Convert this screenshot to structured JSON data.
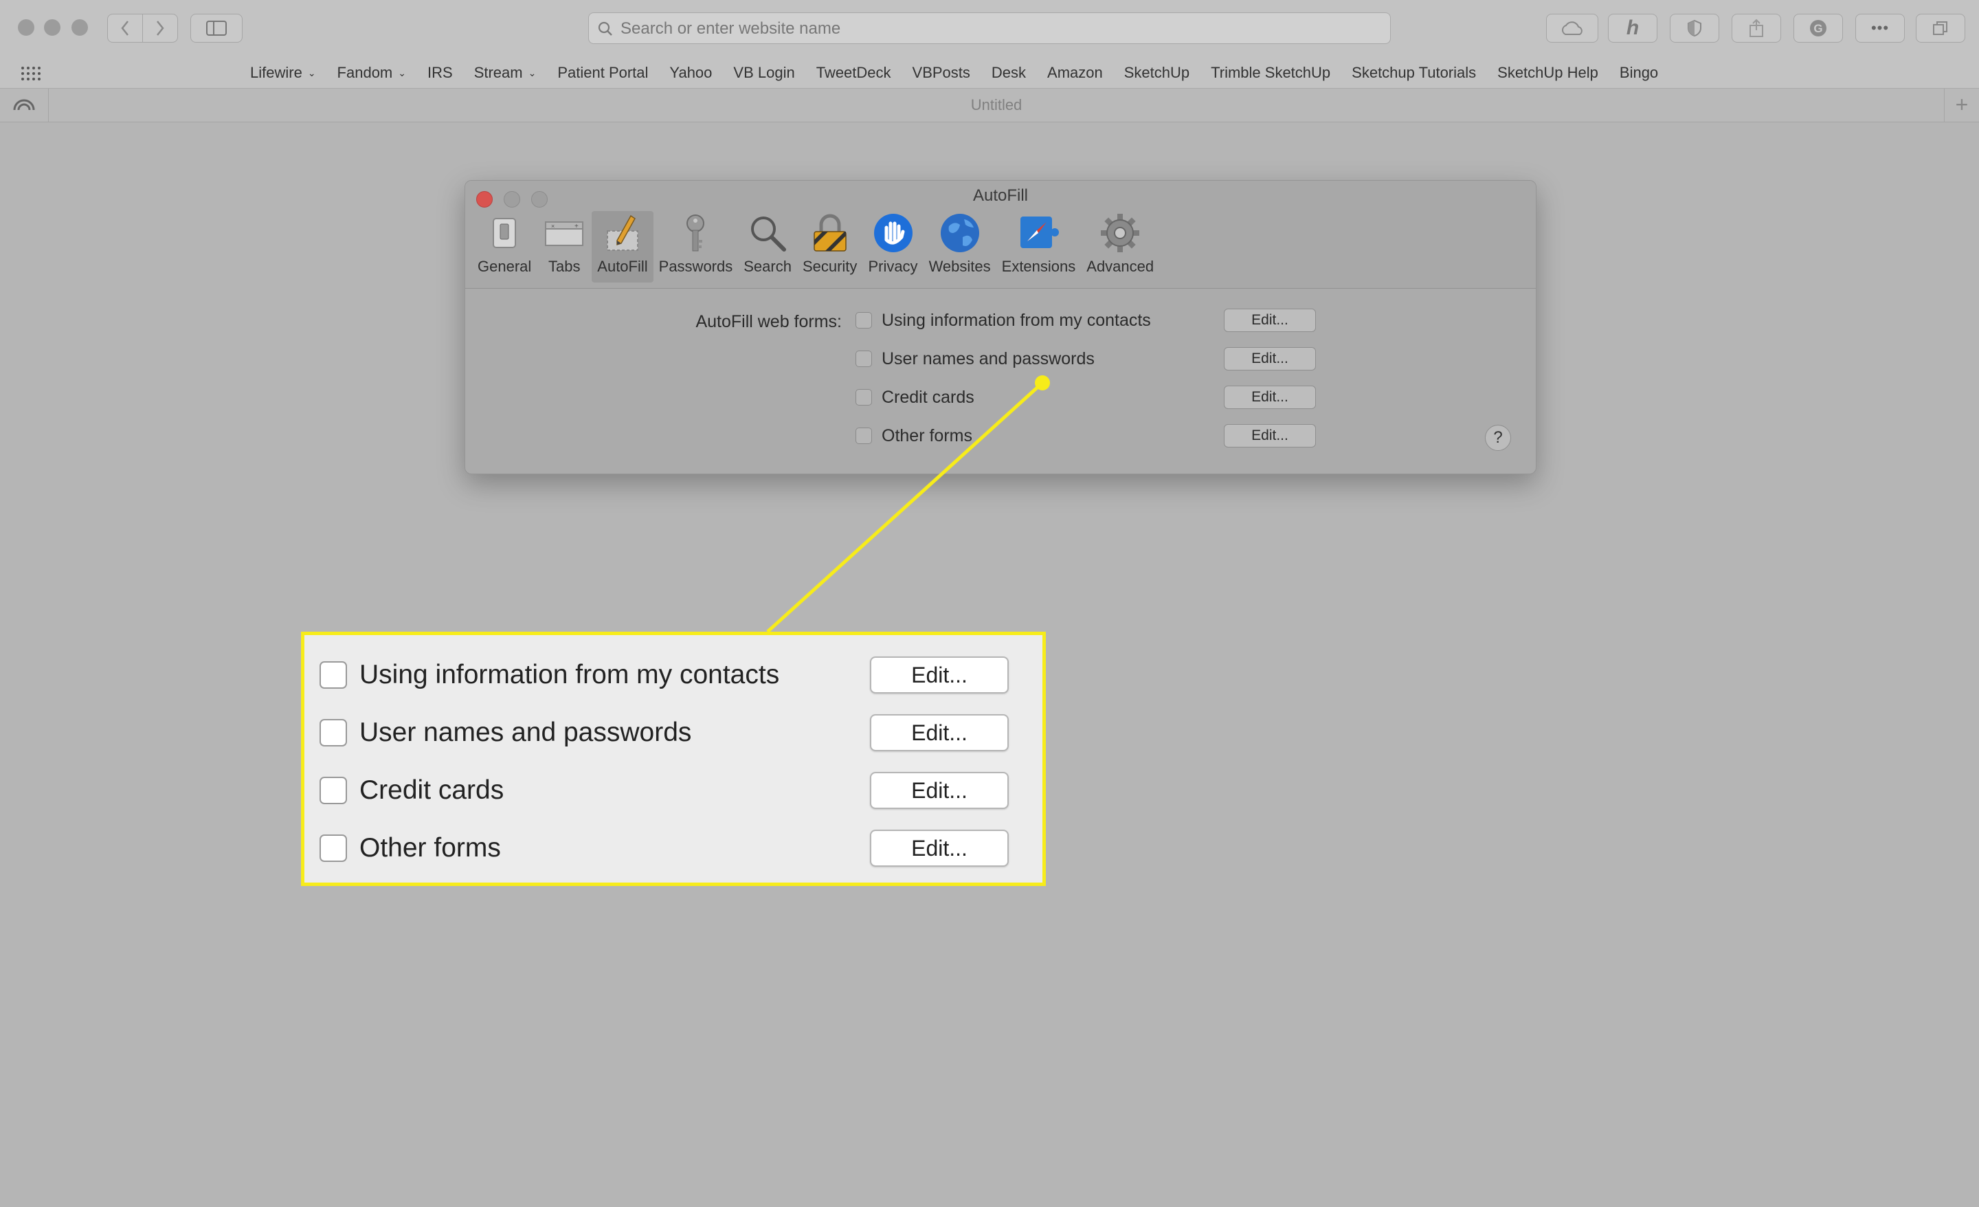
{
  "browser": {
    "address_placeholder": "Search or enter website name",
    "favorites": [
      {
        "label": "Lifewire",
        "menu": true
      },
      {
        "label": "Fandom",
        "menu": true
      },
      {
        "label": "IRS",
        "menu": false
      },
      {
        "label": "Stream",
        "menu": true
      },
      {
        "label": "Patient Portal",
        "menu": false
      },
      {
        "label": "Yahoo",
        "menu": false
      },
      {
        "label": "VB Login",
        "menu": false
      },
      {
        "label": "TweetDeck",
        "menu": false
      },
      {
        "label": "VBPosts",
        "menu": false
      },
      {
        "label": "Desk",
        "menu": false
      },
      {
        "label": "Amazon",
        "menu": false
      },
      {
        "label": "SketchUp",
        "menu": false
      },
      {
        "label": "Trimble SketchUp",
        "menu": false
      },
      {
        "label": "Sketchup Tutorials",
        "menu": false
      },
      {
        "label": "SketchUp Help",
        "menu": false
      },
      {
        "label": "Bingo",
        "menu": false
      }
    ],
    "tab_title": "Untitled",
    "new_tab": "+"
  },
  "prefs": {
    "window_title": "AutoFill",
    "tabs": [
      "General",
      "Tabs",
      "AutoFill",
      "Passwords",
      "Search",
      "Security",
      "Privacy",
      "Websites",
      "Extensions",
      "Advanced"
    ],
    "active_tab": "AutoFill",
    "autofill_label": "AutoFill web forms:",
    "options": [
      {
        "label": "Using information from my contacts",
        "checked": false,
        "edit": "Edit..."
      },
      {
        "label": "User names and passwords",
        "checked": false,
        "edit": "Edit..."
      },
      {
        "label": "Credit cards",
        "checked": false,
        "edit": "Edit..."
      },
      {
        "label": "Other forms",
        "checked": false,
        "edit": "Edit..."
      }
    ],
    "help": "?"
  },
  "colors": {
    "callout_yellow": "#f7ec1a",
    "close_red": "#d9534f",
    "privacy_blue": "#1e6fd9"
  }
}
